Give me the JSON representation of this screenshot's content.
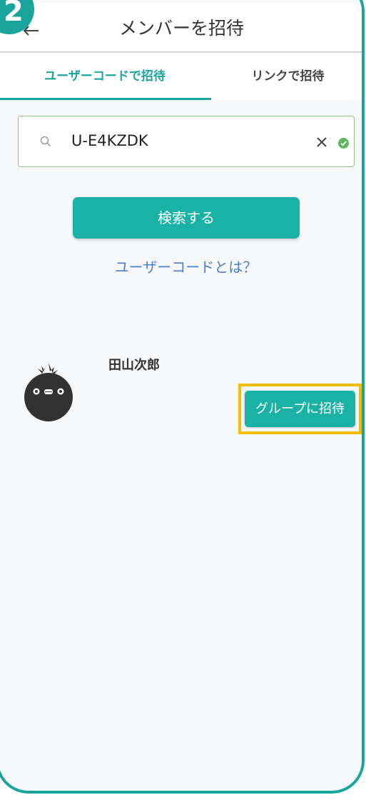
{
  "step": {
    "number": "2"
  },
  "header": {
    "title": "メンバーを招待",
    "back_icon": "back-arrow-icon"
  },
  "tabs": [
    {
      "label": "ユーザーコードで招待",
      "active": true
    },
    {
      "label": "リンクで招待",
      "active": false
    }
  ],
  "search": {
    "value": "U-E4KZDK",
    "icon": "search-icon",
    "clear_icon": "close-icon",
    "valid_icon": "check-circle-icon"
  },
  "search_button": {
    "label": "検索する"
  },
  "help_link": {
    "label": "ユーザーコードとは？"
  },
  "result": {
    "name": "田山次郎",
    "invite_label": "グループに招待",
    "avatar_icon": "bird-avatar-icon"
  },
  "colors": {
    "accent": "#1aa59c",
    "button": "#1ab2a6",
    "highlight": "#f5bd00",
    "link": "#4a7fd0",
    "valid": "#5cb85c"
  }
}
